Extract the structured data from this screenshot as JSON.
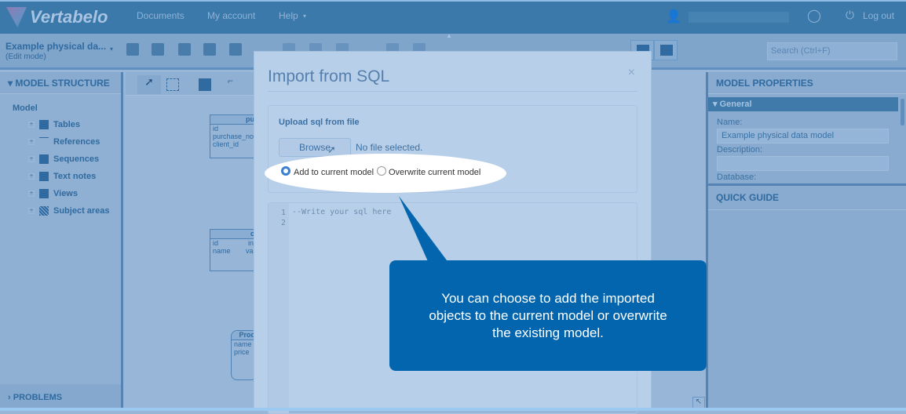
{
  "app": {
    "brand": "Vertabelo"
  },
  "nav": {
    "items": [
      "Documents",
      "My account",
      "Help"
    ],
    "logout": "Log out"
  },
  "toolbar": {
    "model_title": "Example physical da...",
    "model_mode": "(Edit mode)",
    "search_placeholder": "Search (Ctrl+F)"
  },
  "left_panel": {
    "title": "MODEL STRUCTURE",
    "root": "Model",
    "items": [
      {
        "label": "Tables",
        "icon": "table-icon"
      },
      {
        "label": "References",
        "icon": "reference-icon"
      },
      {
        "label": "Sequences",
        "icon": "sequence-icon"
      },
      {
        "label": "Text notes",
        "icon": "note-icon"
      },
      {
        "label": "Views",
        "icon": "view-icon"
      },
      {
        "label": "Subject areas",
        "icon": "subject-area-icon"
      }
    ],
    "problems": "PROBLEMS"
  },
  "canvas": {
    "tables": [
      {
        "name": "pu",
        "columns": [
          "id",
          "purchase_no",
          "client_id"
        ]
      },
      {
        "name": "c",
        "columns": [
          "id",
          "name"
        ],
        "types": [
          "in",
          "va"
        ]
      },
      {
        "name": "Prod",
        "columns": [
          "name",
          "price"
        ]
      }
    ]
  },
  "right_panel": {
    "title": "MODEL PROPERTIES",
    "section": "General",
    "name_label": "Name:",
    "name_value": "Example physical data model",
    "description_label": "Description:",
    "description_value": "",
    "database_label": "Database:",
    "quick_guide": "QUICK GUIDE"
  },
  "modal": {
    "title": "Import from SQL",
    "close": "×",
    "upload_label": "Upload sql from file",
    "browse": "Browse",
    "no_file": "No file selected.",
    "options": [
      {
        "label": "Add to current model",
        "selected": true
      },
      {
        "label": "Overwrite current model",
        "selected": false
      }
    ],
    "line_numbers": [
      "1",
      "2"
    ],
    "code_placeholder": "--Write your sql here"
  },
  "callout": {
    "text": "You can choose to add the imported objects to the current model or overwrite the existing model.",
    "color": "#0365ae"
  }
}
